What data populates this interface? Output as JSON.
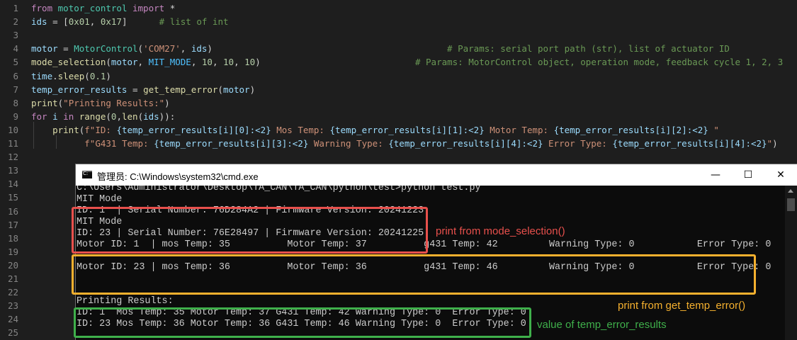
{
  "editor": {
    "lines": [
      {
        "no": "1",
        "parts": [
          [
            "kw",
            "from "
          ],
          [
            "cls",
            "motor_control "
          ],
          [
            "kw",
            "import "
          ],
          [
            "pun",
            "*"
          ]
        ]
      },
      {
        "no": "2",
        "parts": [
          [
            "var",
            "ids "
          ],
          [
            "pun",
            "= ["
          ],
          [
            "num",
            "0x01"
          ],
          [
            "pun",
            ", "
          ],
          [
            "num",
            "0x17"
          ],
          [
            "pun",
            "]      "
          ],
          [
            "cmt",
            "# list of int"
          ]
        ]
      },
      {
        "no": "3",
        "parts": []
      },
      {
        "no": "4",
        "parts": [
          [
            "var",
            "motor "
          ],
          [
            "pun",
            "= "
          ],
          [
            "cls",
            "MotorControl"
          ],
          [
            "pun",
            "("
          ],
          [
            "str",
            "'COM27'"
          ],
          [
            "pun",
            ", "
          ],
          [
            "var",
            "ids"
          ],
          [
            "pun",
            ")                                            "
          ],
          [
            "cmt",
            "# Params: serial port path (str), list of actuator ID"
          ]
        ]
      },
      {
        "no": "5",
        "parts": [
          [
            "fn",
            "mode_selection"
          ],
          [
            "pun",
            "("
          ],
          [
            "var",
            "motor"
          ],
          [
            "pun",
            ", "
          ],
          [
            "const",
            "MIT_MODE"
          ],
          [
            "pun",
            ", "
          ],
          [
            "num",
            "10"
          ],
          [
            "pun",
            ", "
          ],
          [
            "num",
            "10"
          ],
          [
            "pun",
            ", "
          ],
          [
            "num",
            "10"
          ],
          [
            "pun",
            ")                             "
          ],
          [
            "cmt",
            "# Params: MotorControl object, operation mode, feedback cycle 1, 2, 3"
          ]
        ]
      },
      {
        "no": "6",
        "parts": [
          [
            "var",
            "time"
          ],
          [
            "pun",
            "."
          ],
          [
            "fn",
            "sleep"
          ],
          [
            "pun",
            "("
          ],
          [
            "num",
            "0.1"
          ],
          [
            "pun",
            ")"
          ]
        ]
      },
      {
        "no": "7",
        "parts": [
          [
            "var",
            "temp_error_results "
          ],
          [
            "pun",
            "= "
          ],
          [
            "fn",
            "get_temp_error"
          ],
          [
            "pun",
            "("
          ],
          [
            "var",
            "motor"
          ],
          [
            "pun",
            ")"
          ]
        ]
      },
      {
        "no": "8",
        "parts": [
          [
            "fn",
            "print"
          ],
          [
            "pun",
            "("
          ],
          [
            "str",
            "\"Printing Results:\""
          ],
          [
            "pun",
            ")"
          ]
        ]
      },
      {
        "no": "9",
        "parts": [
          [
            "kw",
            "for "
          ],
          [
            "var",
            "i "
          ],
          [
            "kw",
            "in "
          ],
          [
            "fn",
            "range"
          ],
          [
            "pun",
            "("
          ],
          [
            "num",
            "0"
          ],
          [
            "pun",
            ","
          ],
          [
            "fn",
            "len"
          ],
          [
            "pun",
            "("
          ],
          [
            "var",
            "ids"
          ],
          [
            "pun",
            "))"
          ],
          [
            "pun",
            ":"
          ]
        ]
      },
      {
        "no": "10",
        "parts": [
          [
            "pun",
            "    "
          ],
          [
            "fn",
            "print"
          ],
          [
            "pun",
            "("
          ],
          [
            "str",
            "f\"ID: "
          ],
          [
            "ph",
            "{temp_error_results[i][0]:<2}"
          ],
          [
            "str",
            " Mos Temp: "
          ],
          [
            "ph",
            "{temp_error_results[i][1]:<2}"
          ],
          [
            "str",
            " Motor Temp: "
          ],
          [
            "ph",
            "{temp_error_results[i][2]:<2}"
          ],
          [
            "str",
            " \""
          ]
        ]
      },
      {
        "no": "11",
        "parts": [
          [
            "pun",
            "          "
          ],
          [
            "str",
            "f\"G431 Temp: "
          ],
          [
            "ph",
            "{temp_error_results[i][3]:<2}"
          ],
          [
            "str",
            " Warning Type: "
          ],
          [
            "ph",
            "{temp_error_results[i][4]:<2}"
          ],
          [
            "str",
            " Error Type: "
          ],
          [
            "ph",
            "{temp_error_results[i][4]:<2}"
          ],
          [
            "str",
            "\""
          ],
          [
            "pun",
            ")"
          ]
        ]
      },
      {
        "no": "12",
        "parts": []
      },
      {
        "no": "13",
        "parts": []
      },
      {
        "no": "14",
        "parts": []
      },
      {
        "no": "15",
        "parts": []
      },
      {
        "no": "16",
        "parts": []
      },
      {
        "no": "17",
        "parts": []
      },
      {
        "no": "18",
        "parts": []
      },
      {
        "no": "19",
        "parts": []
      },
      {
        "no": "20",
        "parts": []
      },
      {
        "no": "21",
        "parts": []
      },
      {
        "no": "22",
        "parts": []
      },
      {
        "no": "23",
        "parts": []
      },
      {
        "no": "24",
        "parts": []
      },
      {
        "no": "25",
        "parts": []
      }
    ]
  },
  "cmd_window": {
    "title": "管理员: C:\\Windows\\system32\\cmd.exe",
    "minimize": "—",
    "maximize": "☐",
    "close": "✕",
    "lines": [
      "C:\\Users\\Administrator\\Desktop\\TA_CAN\\TA_CAN\\python\\test>python test.py",
      "MIT Mode",
      "ID: 1  | Serial Number: 76D284A2 | Firmware Version: 20241223",
      "MIT Mode",
      "ID: 23 | Serial Number: 76E28497 | Firmware Version: 20241225",
      "Motor ID: 1  | mos Temp: 35          Motor Temp: 37          g431 Temp: 42         Warning Type: 0           Error Type: 0",
      "",
      "Motor ID: 23 | mos Temp: 36          Motor Temp: 36          g431 Temp: 46         Warning Type: 0           Error Type: 0",
      "",
      "Printing Results:",
      "ID: 1  Mos Temp: 35 Motor Temp: 37 G431 Temp: 42 Warning Type: 0  Error Type: 0",
      "ID: 23 Mos Temp: 36 Motor Temp: 36 G431 Temp: 46 Warning Type: 0  Error Type: 0"
    ]
  },
  "annotations": {
    "red_label": "print from mode_selection()",
    "yellow_label": "print from get_temp_error()",
    "green_label": "value of temp_error_results",
    "colors": {
      "red": "#e8504c",
      "yellow": "#f5b02e",
      "green": "#3fb04b"
    }
  }
}
